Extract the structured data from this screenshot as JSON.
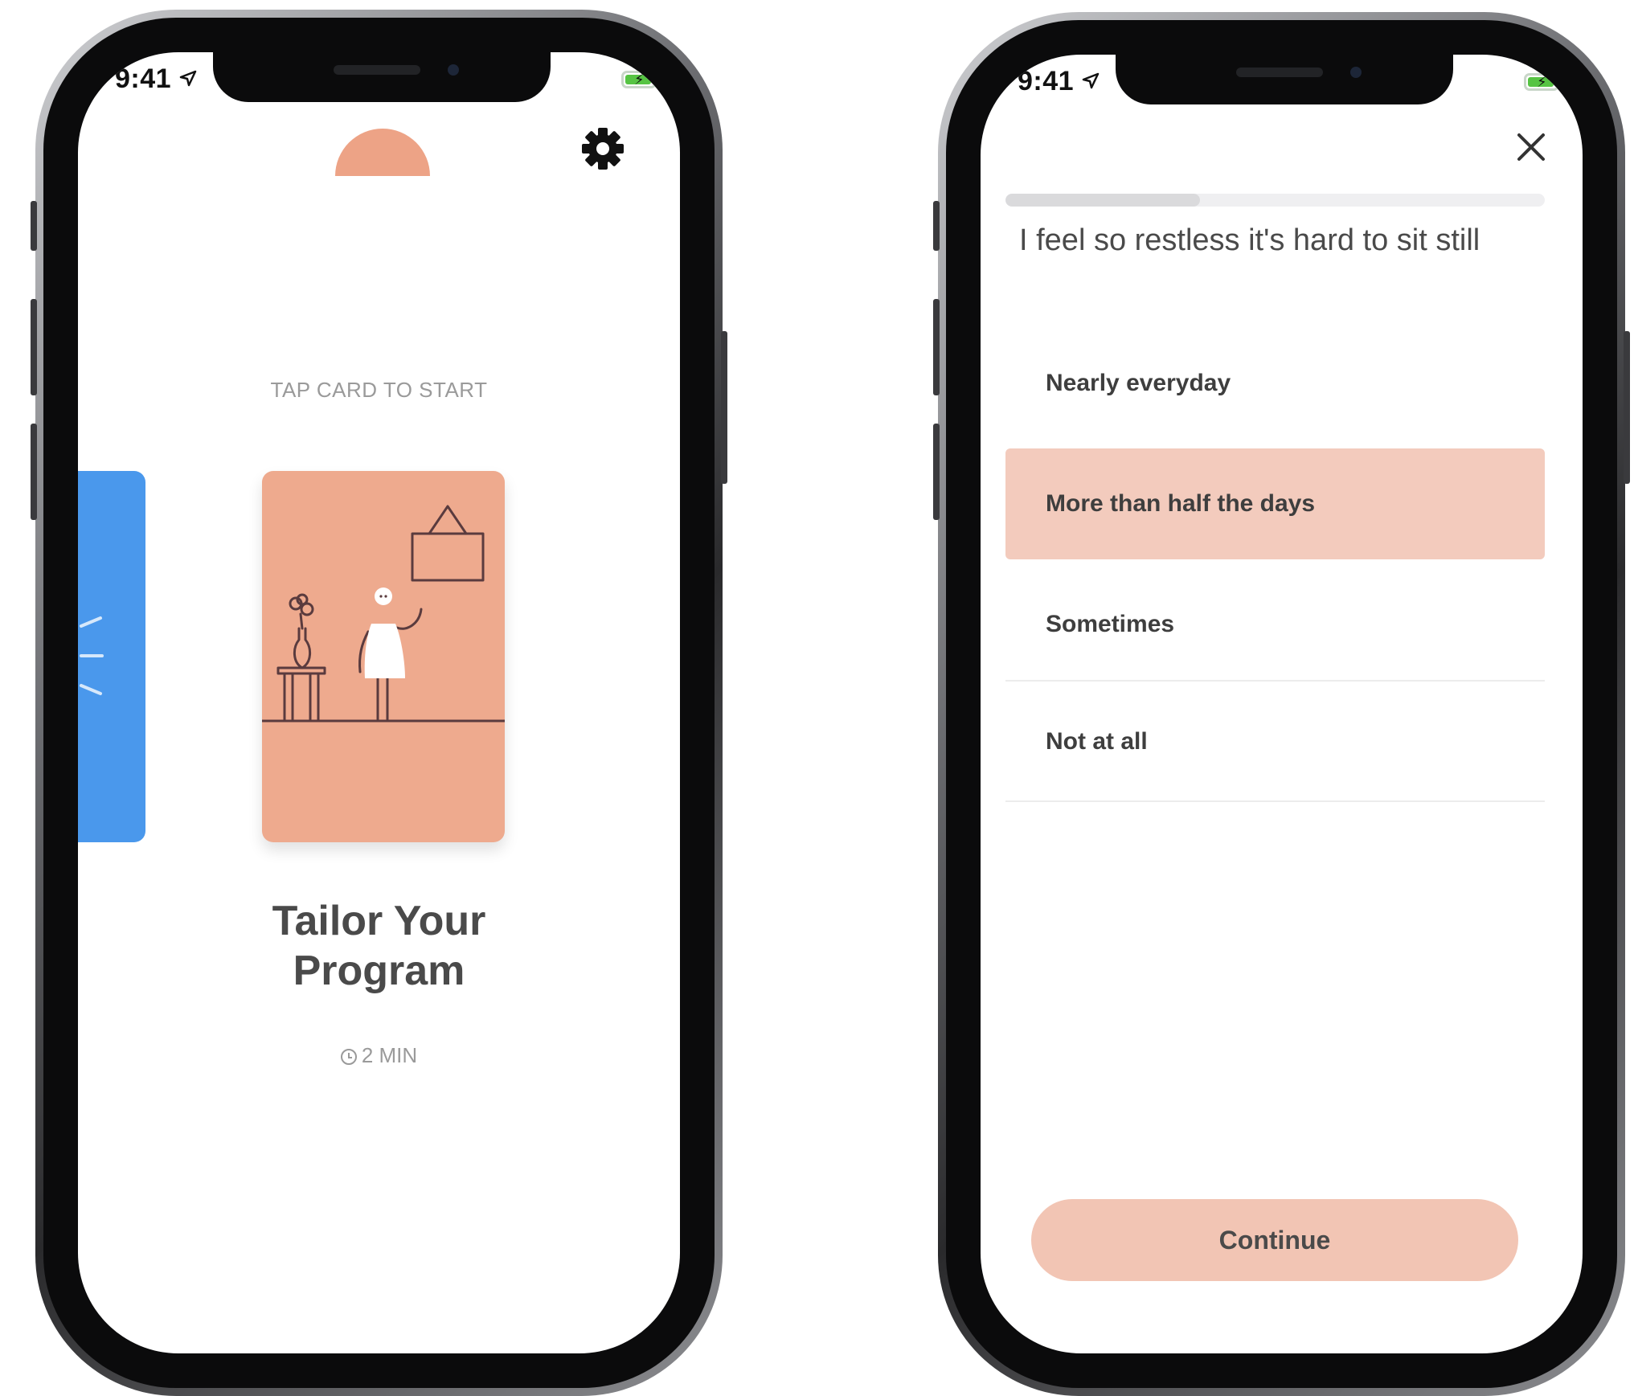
{
  "status_bar": {
    "time": "9:41"
  },
  "intro_screen": {
    "tap_prompt": "TAP CARD TO START",
    "card_title_line1": "Tailor Your",
    "card_title_line2": "Program",
    "duration": "2 MIN"
  },
  "question_screen": {
    "progress": 0.36,
    "question": "I feel so restless it's hard to sit still",
    "options": [
      {
        "label": "Nearly everyday",
        "selected": false
      },
      {
        "label": "More than half the days",
        "selected": true
      },
      {
        "label": "Sometimes",
        "selected": false
      },
      {
        "label": "Not at all",
        "selected": false
      }
    ],
    "continue_label": "Continue"
  },
  "colors": {
    "accent_peach": "#eeaa8e",
    "selected_option": "#f3cbbd",
    "continue_button": "#f2c5b4",
    "side_card_blue": "#4a98ec"
  }
}
